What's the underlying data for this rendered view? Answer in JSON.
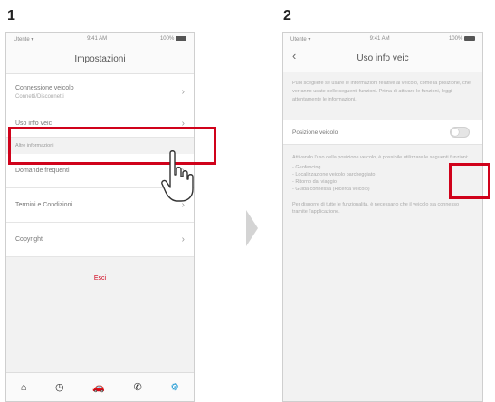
{
  "steps": {
    "first": "1",
    "second": "2"
  },
  "status": {
    "carrier": "Utente ▾",
    "time": "9:41 AM",
    "battery": "100%"
  },
  "screen1": {
    "title": "Impostazioni",
    "items": [
      {
        "label": "Connessione veicolo",
        "sub": "Connetti/Disconnetti"
      },
      {
        "label": "Uso info veic"
      }
    ],
    "section_header": "Altre informazioni",
    "more_items": [
      {
        "label": "Domande frequenti"
      },
      {
        "label": "Termini e Condizioni"
      },
      {
        "label": "Copyright"
      }
    ],
    "logout": "Esci"
  },
  "screen2": {
    "title": "Uso info veic",
    "intro": "Puoi scegliere se usare le informazioni relative al veicolo, come la posizione, che verranno usate nelle seguenti funzioni. Prima di attivare le funzioni, leggi attentamente le informazioni.",
    "toggle_label": "Posizione veicolo",
    "desc1": "Attivando l'uso della posizione veicolo, è possibile utilizzare le seguenti funzioni:",
    "bullets": [
      "- Geofencing",
      "- Localizzazione veicolo parcheggiato",
      "- Ritorno dal viaggio",
      "- Guida connessa (Ricerca veicolo)"
    ],
    "desc2": "Per disporre di tutte le funzionalità, è necessario che il veicolo sia connesso tramite l'applicazione."
  },
  "tabs": [
    "home-icon",
    "history-icon",
    "car-icon",
    "phone-icon",
    "settings-icon"
  ],
  "colors": {
    "highlight": "#d0021b",
    "active_tab": "#2b9fd6"
  }
}
